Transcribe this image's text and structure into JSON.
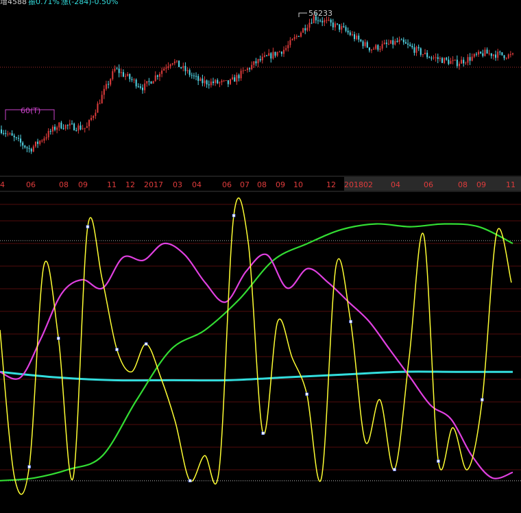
{
  "header": {
    "vol_label": "增4588",
    "swing_label": "振0.71%",
    "change_label": "涨(-284)-0.50%"
  },
  "colors": {
    "up_candle": "#e03c3c",
    "down_candle": "#54d8e8",
    "axis_red": "#e03c3c",
    "grid_red": "#6e0f0f",
    "yellow": "#ffff33",
    "magenta": "#e040e0",
    "green": "#33dd33",
    "cyan": "#33dddd",
    "period_marker": "#cc44cc"
  },
  "price_panel": {
    "peak_label": "56233",
    "period_marker_label": "60(T)"
  },
  "time_axis": {
    "labels": [
      "4",
      "06",
      "08",
      "09",
      "11",
      "12",
      "2017",
      "03",
      "04",
      "06",
      "07",
      "08",
      "09",
      "10",
      "12",
      "201802",
      "04",
      "06",
      "08",
      "09",
      "11"
    ],
    "highlighted_label": "201802"
  },
  "chart_data": {
    "type": "line",
    "title": "",
    "price_series": {
      "name": "price",
      "x": [
        "2016-04",
        "2016-06",
        "2016-08",
        "2016-10",
        "2016-11",
        "2016-12",
        "2017-01",
        "2017-03",
        "2017-05",
        "2017-07",
        "2017-08",
        "2017-10",
        "2017-12",
        "2018-02",
        "2018-04",
        "2018-06",
        "2018-08",
        "2018-10",
        "2018-11"
      ],
      "y": [
        0.22,
        0.08,
        0.25,
        0.23,
        0.64,
        0.51,
        0.7,
        0.55,
        0.54,
        0.69,
        0.78,
        1.0,
        0.92,
        0.78,
        0.83,
        0.73,
        0.68,
        0.75,
        0.73
      ],
      "peak_value": 56233
    },
    "indicator_series": [
      {
        "name": "",
        "color": "yellow",
        "y": [
          0.55,
          0.02,
          0.06,
          0.78,
          0.52,
          0.02,
          0.92,
          0.73,
          0.48,
          0.4,
          0.5,
          0.38,
          0.22,
          0.01,
          0.1,
          0.05,
          0.96,
          0.86,
          0.18,
          0.58,
          0.45,
          0.32,
          0.02,
          0.78,
          0.58,
          0.15,
          0.3,
          0.05,
          0.45,
          0.89,
          0.08,
          0.2,
          0.05,
          0.3,
          0.9,
          0.72
        ]
      },
      {
        "name": "",
        "color": "magenta",
        "y": [
          0.4,
          0.38,
          0.52,
          0.68,
          0.73,
          0.7,
          0.81,
          0.8,
          0.86,
          0.82,
          0.72,
          0.65,
          0.76,
          0.82,
          0.7,
          0.77,
          0.72,
          0.65,
          0.58,
          0.48,
          0.38,
          0.28,
          0.23,
          0.1,
          0.02,
          0.04
        ]
      },
      {
        "name": "",
        "color": "green",
        "y": [
          0.01,
          0.02,
          0.05,
          0.1,
          0.3,
          0.48,
          0.55,
          0.66,
          0.8,
          0.86,
          0.91,
          0.93,
          0.92,
          0.93,
          0.92,
          0.86
        ]
      },
      {
        "name": "",
        "color": "cyan",
        "y": [
          0.4,
          0.38,
          0.37,
          0.37,
          0.37,
          0.38,
          0.39,
          0.4,
          0.4,
          0.4
        ]
      }
    ],
    "reference_lines": [
      0.87,
      0.01
    ],
    "grid": true
  }
}
